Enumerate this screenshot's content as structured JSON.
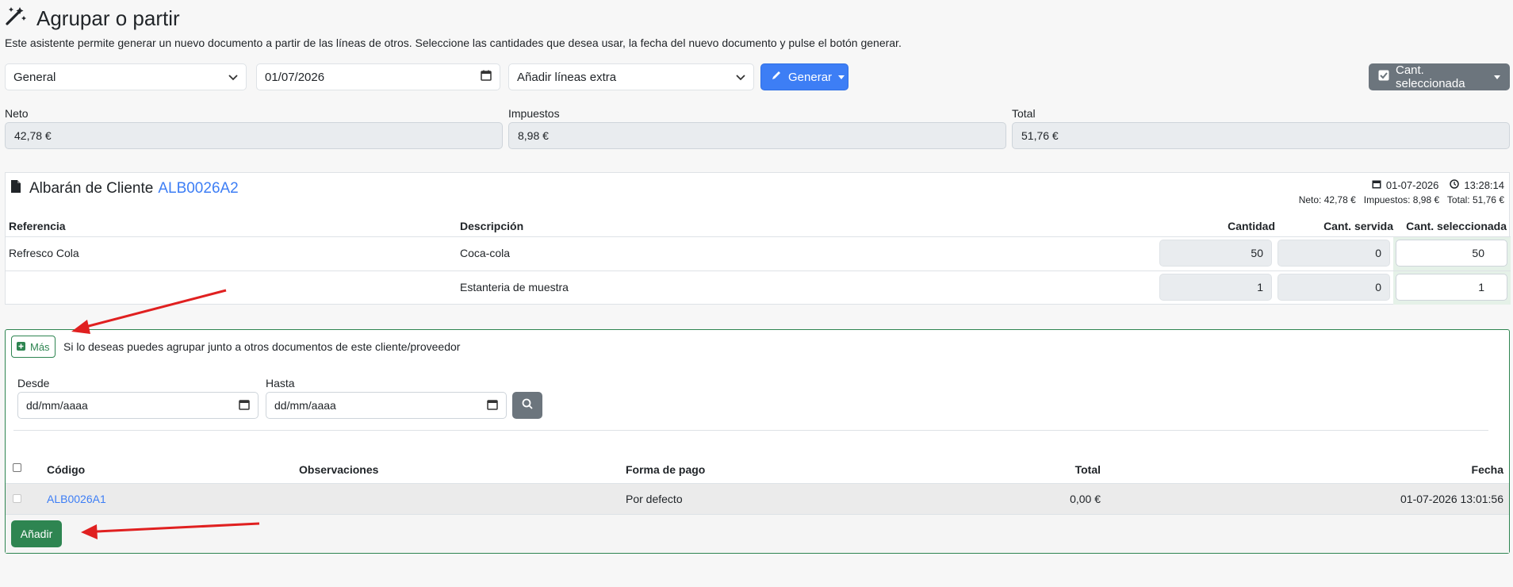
{
  "header": {
    "title": "Agrupar o partir",
    "subtitle": "Este asistente permite generar un nuevo documento a partir de las líneas de otros. Seleccione las cantidades que desea usar, la fecha del nuevo documento y pulse el botón generar."
  },
  "toolbar": {
    "series_value": "General",
    "date_value": "01/07/2026",
    "extra_lines_value": "Añadir líneas extra",
    "generate_label": "Generar",
    "qty_mode_label": "Cant. seleccionada"
  },
  "totals": {
    "net_label": "Neto",
    "net_value": "42,78 €",
    "tax_label": "Impuestos",
    "tax_value": "8,98 €",
    "total_label": "Total",
    "total_value": "51,76 €"
  },
  "document": {
    "title_prefix": "Albarán de Cliente",
    "code": "ALB0026A2",
    "date": "01-07-2026",
    "time": "13:28:14",
    "summary": "Neto: 42,78 €   Impuestos: 8,98 €   Total: 51,76 €",
    "columns": [
      "Referencia",
      "Descripción",
      "Cantidad",
      "Cant. servida",
      "Cant. seleccionada"
    ],
    "lines": [
      {
        "ref": "Refresco Cola",
        "desc": "Coca-cola",
        "qty": "50",
        "served": "0",
        "selected": "50"
      },
      {
        "ref": "",
        "desc": "Estanteria de muestra",
        "qty": "1",
        "served": "0",
        "selected": "1"
      }
    ]
  },
  "group": {
    "more_label": "Más",
    "hint": "Si lo deseas puedes agrupar junto a otros documentos de este cliente/proveedor",
    "from_label": "Desde",
    "from_placeholder": "dd/mm/aaaa",
    "to_label": "Hasta",
    "to_placeholder": "dd/mm/aaaa",
    "columns": [
      "Código",
      "Observaciones",
      "Forma de pago",
      "Total",
      "Fecha"
    ],
    "rows": [
      {
        "code": "ALB0026A1",
        "notes": "",
        "payment": "Por defecto",
        "total": "0,00 €",
        "date": "01-07-2026 13:01:56"
      }
    ],
    "add_label": "Añadir"
  },
  "colors": {
    "primary": "#3d7ef5",
    "success": "#2e8551",
    "secondary": "#6c757d",
    "arrow": "#e02020"
  }
}
